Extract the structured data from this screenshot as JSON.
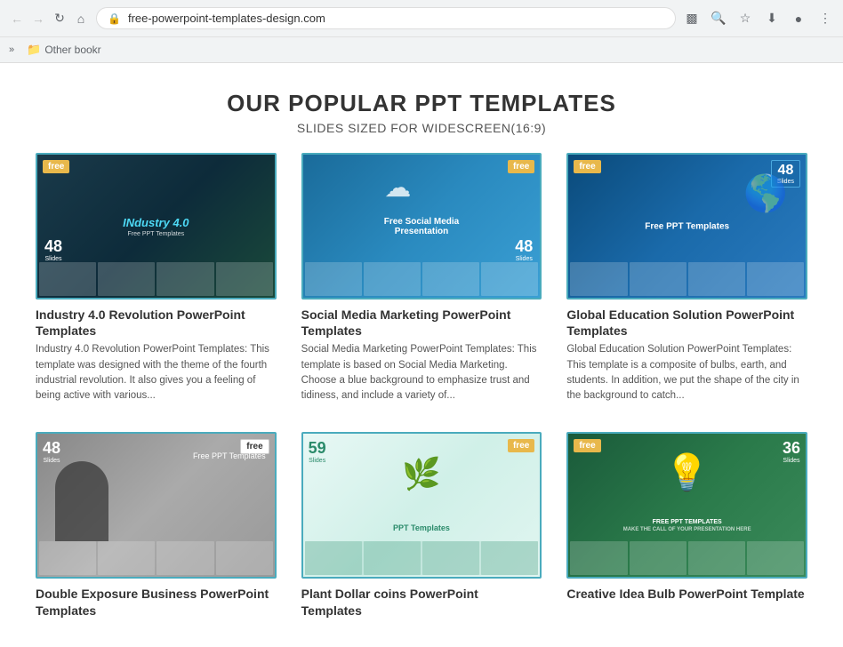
{
  "browser": {
    "address": "free-powerpoint-templates-design.com",
    "bookmarks_label": "Other bookr",
    "chevron": "»"
  },
  "page": {
    "title": "OUR POPULAR PPT TEMPLATES",
    "subtitle": "SLIDES SIZED FOR WIDESCREEN(16:9)"
  },
  "templates": [
    {
      "id": "t1",
      "name": "Industry 4.0 Revolution PowerPoint Templates",
      "desc": "Industry 4.0 Revolution PowerPoint Templates: This template was designed with the theme of the fourth industrial revolution. It also gives you a feeling of being active with various...",
      "badge_free": "free",
      "slides_num": "48",
      "slides_lbl": "Slides",
      "theme": "dark-teal",
      "main_label": "INdustry 4.0",
      "sub_label": "Free PPT Templates"
    },
    {
      "id": "t2",
      "name": "Social Media Marketing PowerPoint Templates",
      "desc": "Social Media Marketing PowerPoint Templates: This template is based on Social Media Marketing. Choose a blue background to emphasize trust and tidiness, and include a variety of...",
      "badge_free": "free",
      "slides_num": "48",
      "slides_lbl": "Slides",
      "theme": "blue",
      "main_label": "Free Social Media Presentation",
      "sub_label": ""
    },
    {
      "id": "t3",
      "name": "Global Education Solution PowerPoint Templates",
      "desc": "Global Education Solution PowerPoint Templates: This template is a composite of bulbs, earth, and students. In addition, we put the shape of the city in the background to catch...",
      "badge_free": "free",
      "slides_num": "48",
      "slides_lbl": "Slides",
      "theme": "dark-blue",
      "main_label": "Free PPT Templates",
      "sub_label": ""
    },
    {
      "id": "t4",
      "name": "Double Exposure Business PowerPoint Templates",
      "desc": "",
      "badge_free": "free",
      "slides_num": "48",
      "slides_lbl": "Slides",
      "theme": "gray",
      "main_label": "Free PPT Templates",
      "sub_label": ""
    },
    {
      "id": "t5",
      "name": "Plant Dollar coins PowerPoint Templates",
      "desc": "",
      "badge_free": "free",
      "slides_num": "59",
      "slides_lbl": "Slides",
      "theme": "light-teal",
      "main_label": "PPT Templates",
      "sub_label": ""
    },
    {
      "id": "t6",
      "name": "Creative Idea Bulb PowerPoint Template",
      "desc": "",
      "badge_free": "free",
      "slides_num": "36",
      "slides_lbl": "Slides",
      "theme": "dark-green",
      "main_label": "FREE PPT TEMPLATES",
      "sub_label": "MAKE THE CALL OF YOUR PRESENTATION HERE"
    }
  ]
}
